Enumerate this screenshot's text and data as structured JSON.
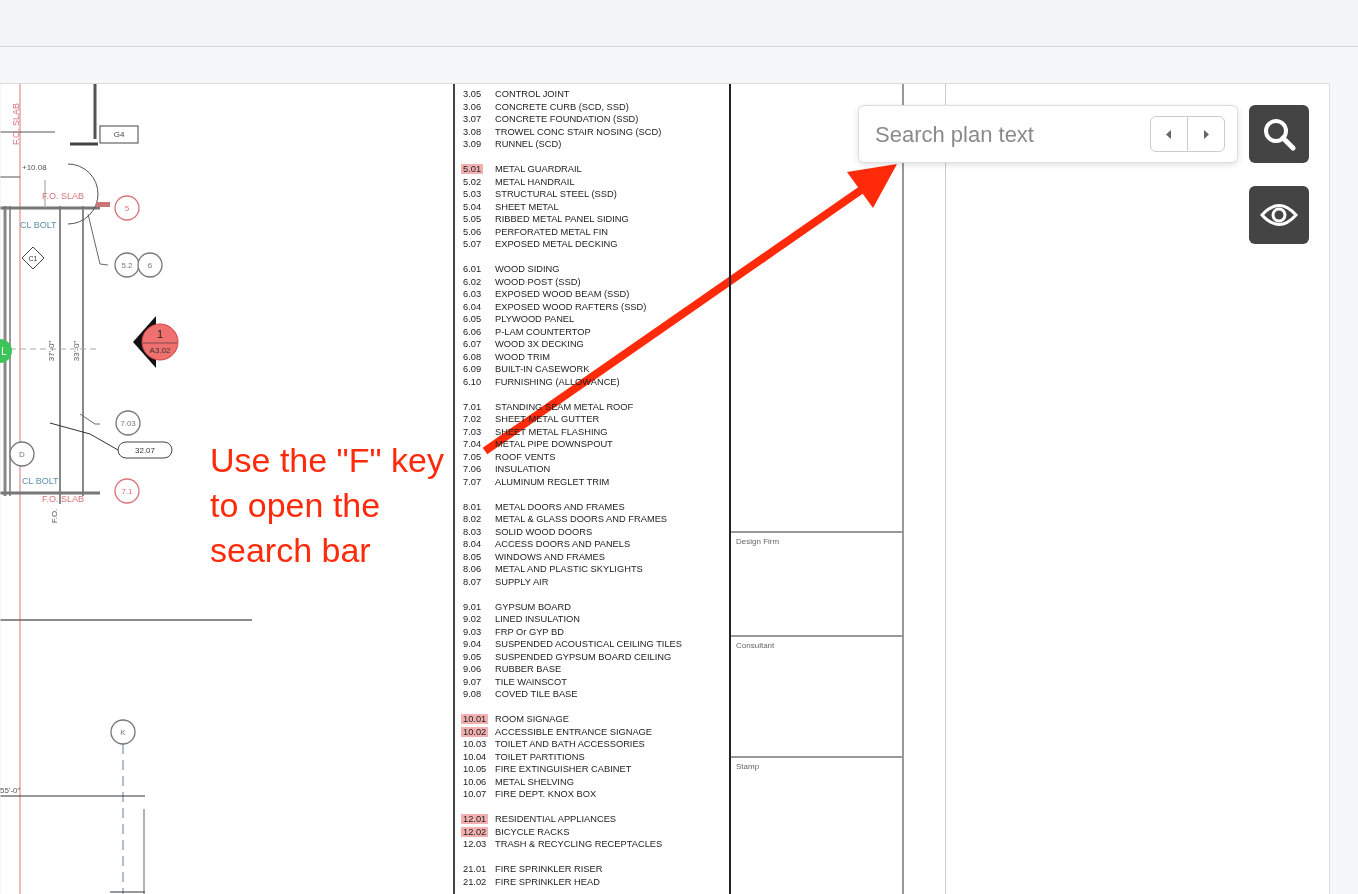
{
  "plan": {
    "labels": [
      {
        "kind": "red-vertical",
        "text": "F.O. SLAB"
      },
      {
        "kind": "box",
        "text": "G4"
      },
      {
        "kind": "note",
        "text": "+10.08"
      },
      {
        "kind": "red-note",
        "text": "F.O. SLAB"
      },
      {
        "kind": "blue-note",
        "text": "CL BOLT"
      },
      {
        "kind": "red-tag",
        "text": "5"
      },
      {
        "kind": "diamond",
        "text": "C1"
      },
      {
        "kind": "tag",
        "text": "5.2"
      },
      {
        "kind": "tag",
        "text": "6"
      },
      {
        "kind": "grid",
        "text": "L"
      },
      {
        "kind": "vertical",
        "text": "37'-0\""
      },
      {
        "kind": "vertical",
        "text": "33'-0\""
      },
      {
        "kind": "section",
        "text": "1",
        "sheet": "A3.02"
      },
      {
        "kind": "tag",
        "text": "7.03"
      },
      {
        "kind": "pill",
        "text": "32.07"
      },
      {
        "kind": "tag",
        "text": "D"
      },
      {
        "kind": "blue-note",
        "text": "CL BOLT"
      },
      {
        "kind": "red-note",
        "text": "F.O. SLAB"
      },
      {
        "kind": "red-tag",
        "text": "7.1"
      },
      {
        "kind": "vertical",
        "text": "F.O."
      },
      {
        "kind": "tag",
        "text": "K"
      },
      {
        "kind": "note",
        "text": "55'-0\""
      }
    ]
  },
  "keynotes": [
    {
      "items": [
        {
          "code": "3.05",
          "text": "CONTROL JOINT",
          "highlighted": false
        },
        {
          "code": "3.06",
          "text": "CONCRETE CURB (SCD, SSD)",
          "highlighted": false
        },
        {
          "code": "3.07",
          "text": "CONCRETE FOUNDATION (SSD)",
          "highlighted": false
        },
        {
          "code": "3.08",
          "text": "TROWEL CONC STAIR NOSING (SCD)",
          "highlighted": false
        },
        {
          "code": "3.09",
          "text": "RUNNEL (SCD)",
          "highlighted": false
        }
      ]
    },
    {
      "items": [
        {
          "code": "5.01",
          "text": "METAL GUARDRAIL",
          "highlighted": true
        },
        {
          "code": "5.02",
          "text": "METAL HANDRAIL",
          "highlighted": false
        },
        {
          "code": "5.03",
          "text": "STRUCTURAL STEEL (SSD)",
          "highlighted": false
        },
        {
          "code": "5.04",
          "text": "SHEET METAL",
          "highlighted": false
        },
        {
          "code": "5.05",
          "text": "RIBBED METAL PANEL SIDING",
          "highlighted": false
        },
        {
          "code": "5.06",
          "text": "PERFORATED METAL FIN",
          "highlighted": false
        },
        {
          "code": "5.07",
          "text": "EXPOSED METAL DECKING",
          "highlighted": false
        }
      ]
    },
    {
      "items": [
        {
          "code": "6.01",
          "text": "WOOD SIDING",
          "highlighted": false
        },
        {
          "code": "6.02",
          "text": "WOOD POST (SSD)",
          "highlighted": false
        },
        {
          "code": "6.03",
          "text": "EXPOSED WOOD BEAM (SSD)",
          "highlighted": false
        },
        {
          "code": "6.04",
          "text": "EXPOSED WOOD RAFTERS (SSD)",
          "highlighted": false
        },
        {
          "code": "6.05",
          "text": "PLYWOOD PANEL",
          "highlighted": false
        },
        {
          "code": "6.06",
          "text": "P-LAM COUNTERTOP",
          "highlighted": false
        },
        {
          "code": "6.07",
          "text": "WOOD 3X DECKING",
          "highlighted": false
        },
        {
          "code": "6.08",
          "text": "WOOD TRIM",
          "highlighted": false
        },
        {
          "code": "6.09",
          "text": "BUILT-IN CASEWORK",
          "highlighted": false
        },
        {
          "code": "6.10",
          "text": "FURNISHING (ALLOWANCE)",
          "highlighted": false
        }
      ]
    },
    {
      "items": [
        {
          "code": "7.01",
          "text": "STANDING SEAM METAL ROOF",
          "highlighted": false
        },
        {
          "code": "7.02",
          "text": "SHEET METAL GUTTER",
          "highlighted": false
        },
        {
          "code": "7.03",
          "text": "SHEET METAL FLASHING",
          "highlighted": false
        },
        {
          "code": "7.04",
          "text": "METAL PIPE DOWNSPOUT",
          "highlighted": false
        },
        {
          "code": "7.05",
          "text": "ROOF VENTS",
          "highlighted": false
        },
        {
          "code": "7.06",
          "text": "INSULATION",
          "highlighted": false
        },
        {
          "code": "7.07",
          "text": "ALUMINUM REGLET TRIM",
          "highlighted": false
        }
      ]
    },
    {
      "items": [
        {
          "code": "8.01",
          "text": "METAL DOORS AND FRAMES",
          "highlighted": false
        },
        {
          "code": "8.02",
          "text": "METAL & GLASS DOORS AND FRAMES",
          "highlighted": false
        },
        {
          "code": "8.03",
          "text": "SOLID WOOD DOORS",
          "highlighted": false
        },
        {
          "code": "8.04",
          "text": "ACCESS DOORS AND PANELS",
          "highlighted": false
        },
        {
          "code": "8.05",
          "text": "WINDOWS AND FRAMES",
          "highlighted": false
        },
        {
          "code": "8.06",
          "text": "METAL AND PLASTIC SKYLIGHTS",
          "highlighted": false
        },
        {
          "code": "8.07",
          "text": "SUPPLY AIR",
          "highlighted": false
        }
      ]
    },
    {
      "items": [
        {
          "code": "9.01",
          "text": "GYPSUM BOARD",
          "highlighted": false
        },
        {
          "code": "9.02",
          "text": "LINED INSULATION",
          "highlighted": false
        },
        {
          "code": "9.03",
          "text": "FRP Or GYP BD",
          "highlighted": false
        },
        {
          "code": "9.04",
          "text": "SUSPENDED ACOUSTICAL CEILING TILES",
          "highlighted": false
        },
        {
          "code": "9.05",
          "text": "SUSPENDED GYPSUM BOARD CEILING",
          "highlighted": false
        },
        {
          "code": "9.06",
          "text": "RUBBER BASE",
          "highlighted": false
        },
        {
          "code": "9.07",
          "text": "TILE WAINSCOT",
          "highlighted": false
        },
        {
          "code": "9.08",
          "text": "COVED TILE BASE",
          "highlighted": false
        }
      ]
    },
    {
      "items": [
        {
          "code": "10.01",
          "text": "ROOM SIGNAGE",
          "highlighted": true
        },
        {
          "code": "10.02",
          "text": "ACCESSIBLE ENTRANCE SIGNAGE",
          "highlighted": true
        },
        {
          "code": "10.03",
          "text": "TOILET AND BATH ACCESSORIES",
          "highlighted": false
        },
        {
          "code": "10.04",
          "text": "TOILET PARTITIONS",
          "highlighted": false
        },
        {
          "code": "10.05",
          "text": "FIRE EXTINGUISHER CABINET",
          "highlighted": false
        },
        {
          "code": "10.06",
          "text": "METAL SHELVING",
          "highlighted": false
        },
        {
          "code": "10.07",
          "text": "FIRE DEPT. KNOX BOX",
          "highlighted": false
        }
      ]
    },
    {
      "items": [
        {
          "code": "12.01",
          "text": "RESIDENTIAL APPLIANCES",
          "highlighted": true
        },
        {
          "code": "12.02",
          "text": "BICYCLE RACKS",
          "highlighted": true
        },
        {
          "code": "12.03",
          "text": "TRASH & RECYCLING RECEPTACLES",
          "highlighted": false
        }
      ]
    },
    {
      "items": [
        {
          "code": "21.01",
          "text": "FIRE SPRINKLER RISER",
          "highlighted": false
        },
        {
          "code": "21.02",
          "text": "FIRE SPRINKLER HEAD",
          "highlighted": false
        }
      ]
    }
  ],
  "title_block": {
    "cells": [
      "Design Firm",
      "Consultant",
      "Stamp"
    ]
  },
  "annotation": {
    "text": "Use the \"F\" key to open the search bar"
  },
  "search": {
    "placeholder": "Search plan text"
  }
}
